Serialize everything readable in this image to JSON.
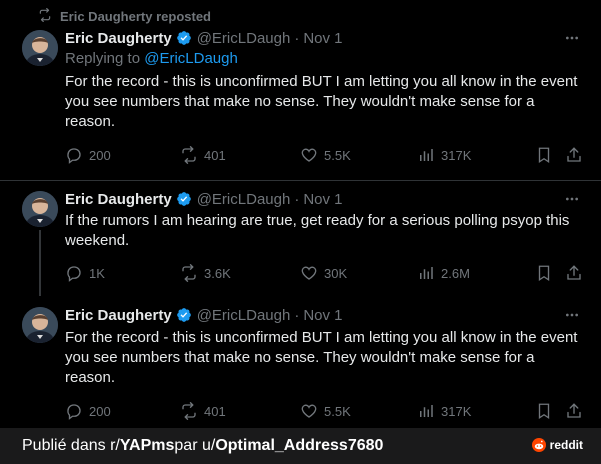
{
  "repost": {
    "text": "Eric Daugherty reposted"
  },
  "tweets": [
    {
      "name": "Eric Daugherty",
      "handle": "@EricLDaugh",
      "dot": "·",
      "date": "Nov 1",
      "replying_prefix": "Replying to",
      "replying_to": "@EricLDaugh",
      "body": "For the record - this is unconfirmed BUT I am letting you all know in the event you see numbers that make no sense. They wouldn't make sense for a reason.",
      "replies": "200",
      "reposts": "401",
      "likes": "5.5K",
      "views": "317K"
    },
    {
      "name": "Eric Daugherty",
      "handle": "@EricLDaugh",
      "dot": "·",
      "date": "Nov 1",
      "body": "If the rumors I am hearing are true, get ready for a serious polling psyop this weekend.",
      "replies": "1K",
      "reposts": "3.6K",
      "likes": "30K",
      "views": "2.6M"
    },
    {
      "name": "Eric Daugherty",
      "handle": "@EricLDaugh",
      "dot": "·",
      "date": "Nov 1",
      "body": "For the record - this is unconfirmed BUT I am letting you all know in the event you see numbers that make no sense. They wouldn't make sense for a reason.",
      "replies": "200",
      "reposts": "401",
      "likes": "5.5K",
      "views": "317K"
    }
  ],
  "footer": {
    "prefix": "Publié dans r/",
    "subreddit": "YAPms",
    "middle": " par u/",
    "user": "Optimal_Address7680",
    "brand": "reddit"
  },
  "colors": {
    "background": "#000000",
    "muted": "#71767b",
    "link": "#1d9bf0",
    "verified": "#1d9bf0",
    "footer_bg": "#1a1a1b",
    "reddit_orange": "#ff4500"
  },
  "icons": [
    "repost-icon",
    "verified-badge-icon",
    "more-icon",
    "reply-icon",
    "retweet-icon",
    "like-icon",
    "views-icon",
    "bookmark-icon",
    "share-icon",
    "reddit-logo-icon"
  ]
}
